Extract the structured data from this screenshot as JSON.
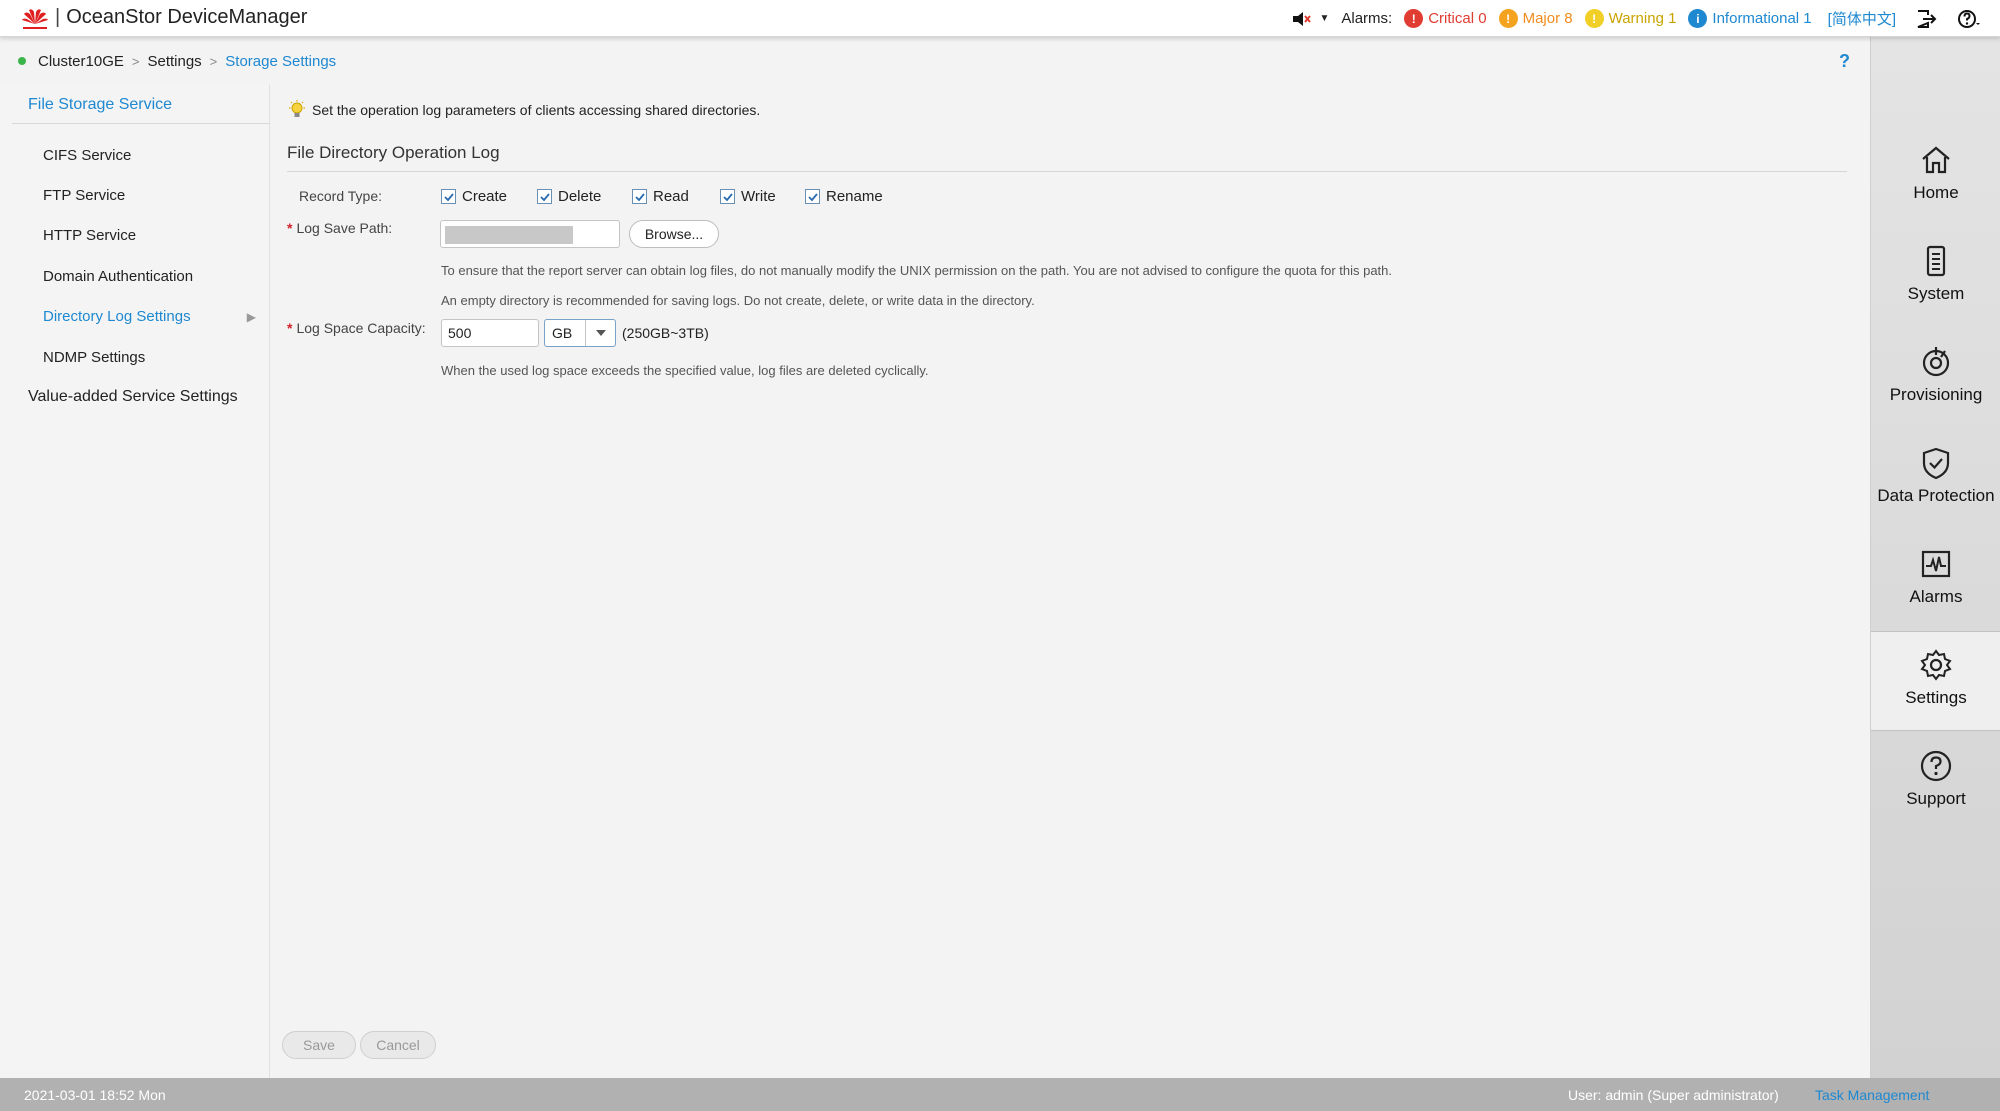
{
  "header": {
    "app_title": "OceanStor DeviceManager",
    "alarms_label": "Alarms:",
    "alarms": {
      "critical": "Critical 0",
      "major": "Major 8",
      "warning": "Warning 1",
      "informational": "Informational 1"
    },
    "language": "[简体中文]"
  },
  "breadcrumb": {
    "cluster": "Cluster10GE",
    "settings": "Settings",
    "current": "Storage Settings",
    "help": "?"
  },
  "leftnav": {
    "group_title": "File Storage Service",
    "items": [
      {
        "label": "CIFS Service"
      },
      {
        "label": "FTP Service"
      },
      {
        "label": "HTTP Service"
      },
      {
        "label": "Domain Authentication"
      },
      {
        "label": "Directory Log Settings"
      },
      {
        "label": "NDMP Settings"
      }
    ],
    "value_added": "Value-added Service Settings"
  },
  "content": {
    "tip": "Set the operation log parameters of clients accessing shared directories.",
    "section_title": "File Directory Operation Log",
    "record_type_label": "Record Type:",
    "record_types": [
      {
        "label": "Create",
        "checked": true
      },
      {
        "label": "Delete",
        "checked": true
      },
      {
        "label": "Read",
        "checked": true
      },
      {
        "label": "Write",
        "checked": true
      },
      {
        "label": "Rename",
        "checked": true
      }
    ],
    "log_save_path_label": "Log Save Path:",
    "browse_label": "Browse...",
    "path_hint_1": "To ensure that the report server can obtain log files, do not manually modify the UNIX permission on the path. You are not advised to configure the quota for this path.",
    "path_hint_2": "An empty directory is recommended for saving logs. Do not create, delete, or write data in the directory.",
    "log_space_label": "Log Space Capacity:",
    "log_space_value": "500",
    "unit": "GB",
    "range": "(250GB~3TB)",
    "capacity_hint": "When the used log space exceeds the specified value, log files are deleted cyclically.",
    "save_label": "Save",
    "cancel_label": "Cancel"
  },
  "rightnav": {
    "items": [
      {
        "label": "Home"
      },
      {
        "label": "System"
      },
      {
        "label": "Provisioning"
      },
      {
        "label": "Data Protection"
      },
      {
        "label": "Alarms"
      },
      {
        "label": "Settings"
      },
      {
        "label": "Support"
      }
    ]
  },
  "footer": {
    "datetime": "2021-03-01 18:52 Mon",
    "user": "User: admin (Super administrator)",
    "task_management": "Task Management"
  },
  "colors": {
    "accent": "#1e88d0",
    "critical": "#e03c31",
    "major": "#f5a21f",
    "warning": "#f1cf26",
    "online": "#3bb54a"
  }
}
